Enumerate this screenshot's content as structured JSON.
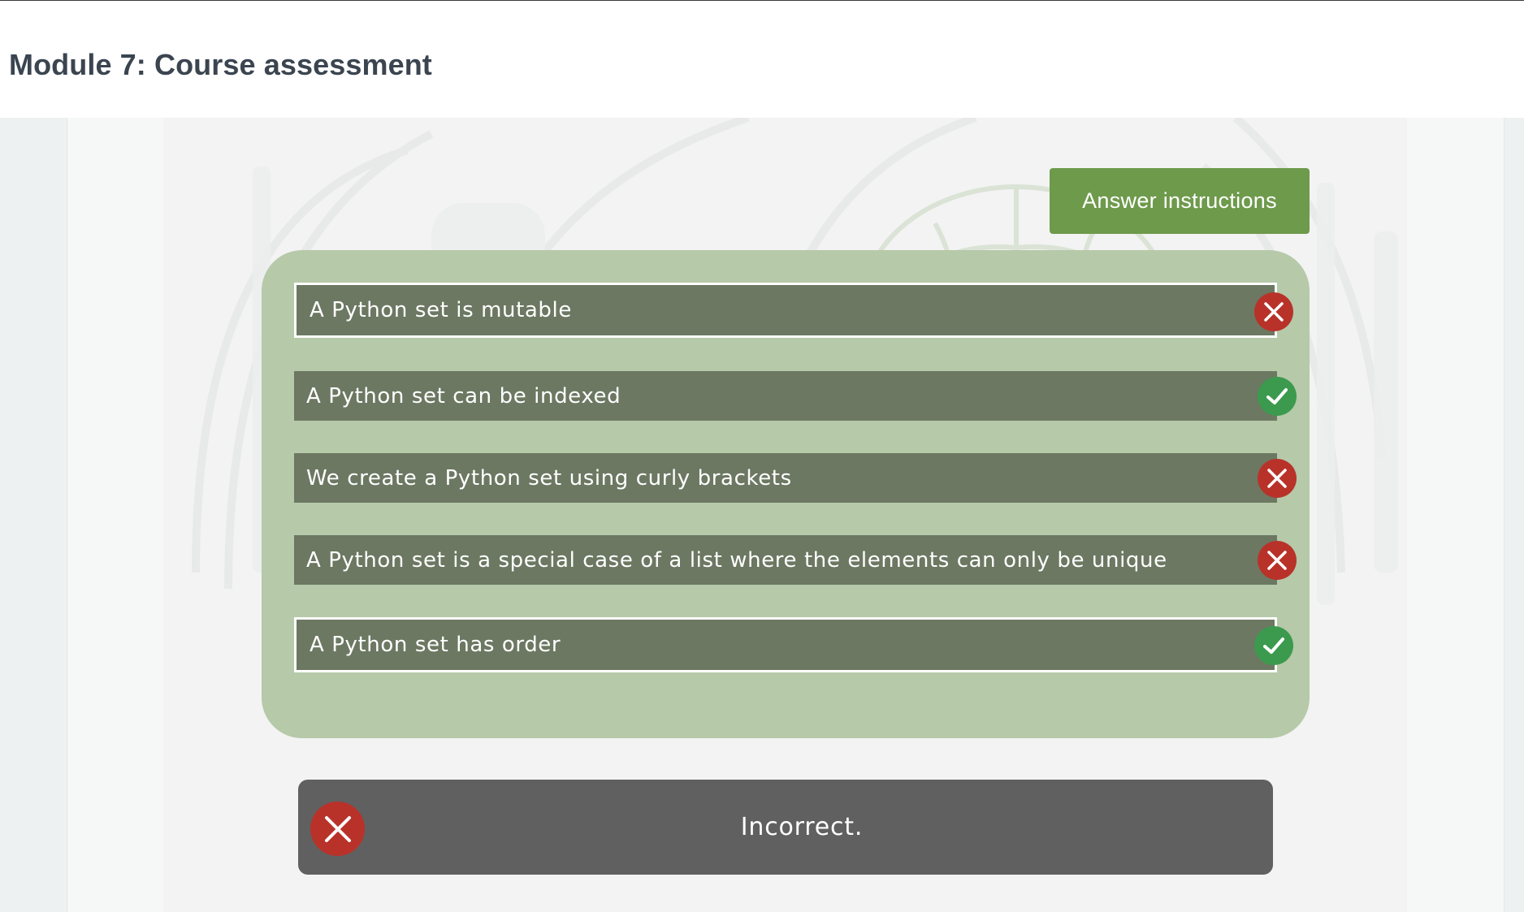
{
  "header": {
    "title": "Module 7: Course assessment"
  },
  "toolbar": {
    "instructions_label": "Answer instructions"
  },
  "answers": [
    {
      "text": "A Python set is mutable",
      "selected": true,
      "status": "incorrect",
      "status_icon": "close-icon"
    },
    {
      "text": "A Python set can be indexed",
      "selected": false,
      "status": "correct",
      "status_icon": "check-icon"
    },
    {
      "text": "We create a Python set using curly brackets",
      "selected": false,
      "status": "incorrect",
      "status_icon": "close-icon"
    },
    {
      "text": "A Python set is a special case of a list where the elements can only be unique",
      "selected": false,
      "status": "incorrect",
      "status_icon": "close-icon"
    },
    {
      "text": "A Python set has order",
      "selected": true,
      "status": "correct",
      "status_icon": "check-icon"
    }
  ],
  "feedback": {
    "text": "Incorrect.",
    "icon": "close-icon"
  },
  "colors": {
    "accent_button": "#6e9a4b",
    "panel": "#b6c9a9",
    "answer_bg": "#6c7862",
    "incorrect": "#b83229",
    "correct": "#3b9a4d",
    "feedback_bg": "#606060"
  }
}
